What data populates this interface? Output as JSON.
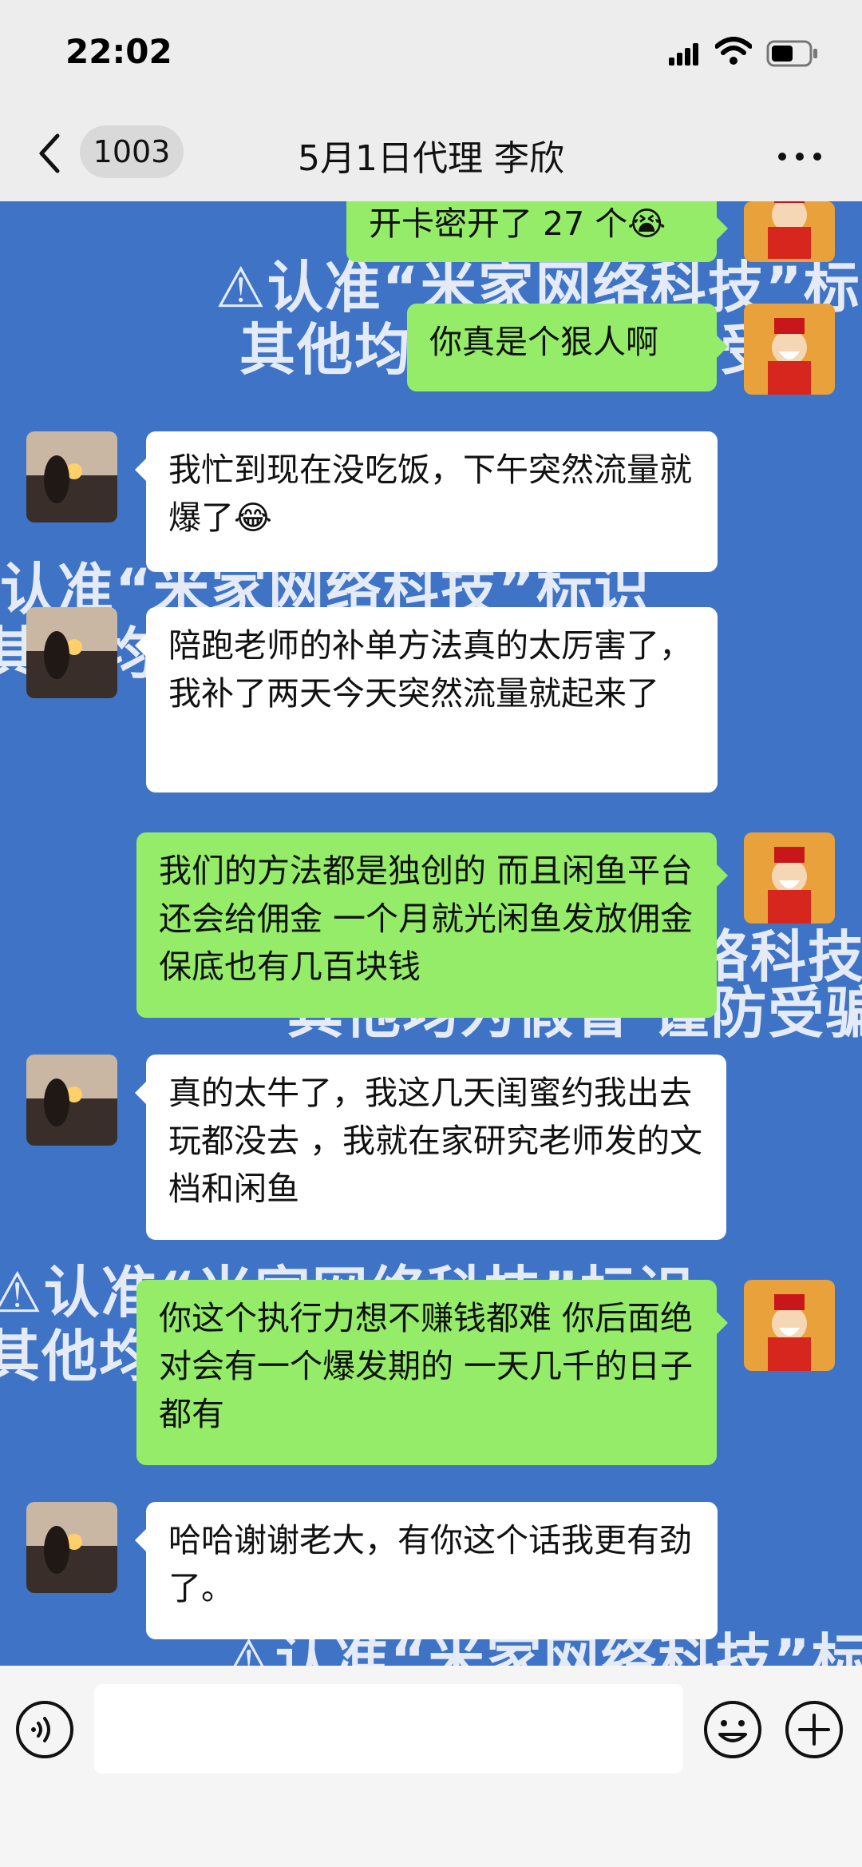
{
  "status": {
    "time": "22:02"
  },
  "nav": {
    "unread_count": "1003",
    "title": "5月1日代理 李欣"
  },
  "watermark": {
    "line1": "认准“米家网络科技”标识",
    "line2": "其他均为假冒 谨防受骗"
  },
  "messages": [
    {
      "side": "out",
      "text": "开卡密开了 27 个😭"
    },
    {
      "side": "out",
      "text": "你真是个狠人啊"
    },
    {
      "side": "in",
      "text": "我忙到现在没吃饭，下午突然流量就爆了😂"
    },
    {
      "side": "in",
      "text": "陪跑老师的补单方法真的太厉害了，我补了两天今天突然流量就起来了"
    },
    {
      "side": "out",
      "text": "我们的方法都是独创的 而且闲鱼平台还会给佣金 一个月就光闲鱼发放佣金保底也有几百块钱"
    },
    {
      "side": "in",
      "text": "真的太牛了，我这几天闺蜜约我出去玩都没去 ，我就在家研究老师发的文档和闲鱼"
    },
    {
      "side": "out",
      "text": "你这个执行力想不赚钱都难 你后面绝对会有一个爆发期的 一天几千的日子都有"
    },
    {
      "side": "in",
      "text": "哈哈谢谢老大，有你这个话我更有劲了。"
    }
  ],
  "icons": {
    "back": "chevron-left-icon",
    "more": "more-dots-icon",
    "voice": "voice-icon",
    "emoji": "emoji-icon",
    "plus": "plus-icon"
  },
  "colors": {
    "chat_background": "#3f73c6",
    "outgoing_bubble": "#95ec69",
    "incoming_bubble": "#ffffff",
    "header_background": "#ededed"
  }
}
